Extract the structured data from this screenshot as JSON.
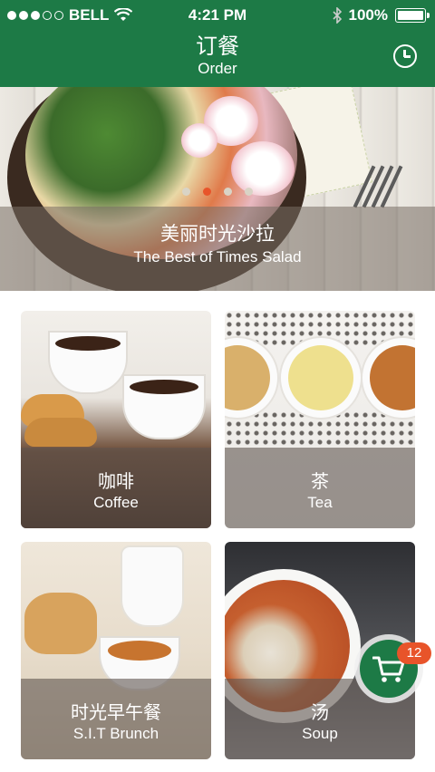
{
  "status_bar": {
    "carrier": "BELL",
    "time": "4:21 PM",
    "battery": "100%",
    "signal_dots": 5,
    "signal_filled": 3
  },
  "nav": {
    "title_cn": "订餐",
    "title_en": "Order",
    "history_icon": "clock-icon"
  },
  "hero": {
    "caption_cn": "美丽时光沙拉",
    "caption_en": "The Best of Times Salad",
    "page_count": 4,
    "active_page": 2
  },
  "categories": [
    {
      "cn": "咖啡",
      "en": "Coffee"
    },
    {
      "cn": "茶",
      "en": "Tea"
    },
    {
      "cn": "时光早午餐",
      "en": "S.I.T Brunch"
    },
    {
      "cn": "汤",
      "en": "Soup"
    }
  ],
  "cart": {
    "icon": "cart-icon",
    "count": "12"
  },
  "colors": {
    "brand_green": "#1d7a46",
    "accent_orange": "#e8542a"
  }
}
